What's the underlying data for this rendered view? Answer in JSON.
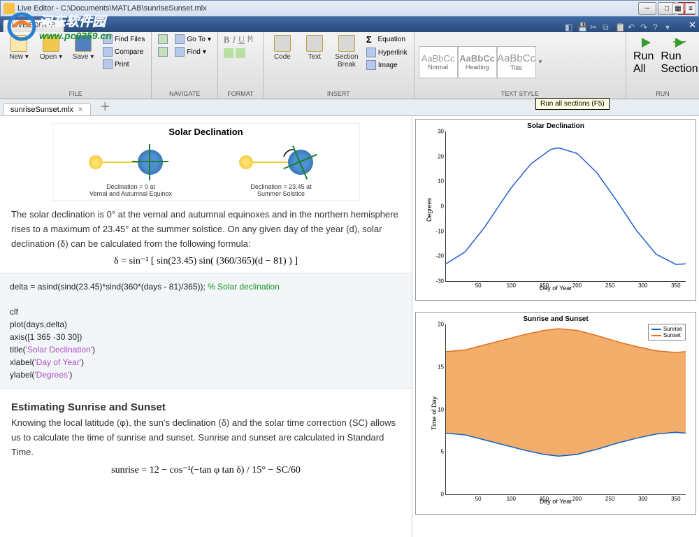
{
  "window": {
    "title": "Live Editor - C:\\Documents\\MATLAB\\sunriseSunset.mlx"
  },
  "watermark": {
    "line1": "河东软件园",
    "line2": "www.pc0359.cn"
  },
  "ribbon_tab": "LIVE EDITOR",
  "tooltip": "Run all sections (F5)",
  "groups": {
    "file": {
      "label": "FILE",
      "new": "New",
      "open": "Open",
      "save": "Save",
      "find_files": "Find Files",
      "compare": "Compare",
      "print": "Print"
    },
    "navigate": {
      "label": "NAVIGATE",
      "goto": "Go To",
      "find": "Find"
    },
    "format": {
      "label": "FORMAT"
    },
    "insert": {
      "label": "INSERT",
      "code": "Code",
      "text": "Text",
      "section": "Section\nBreak",
      "equation": "Equation",
      "hyperlink": "Hyperlink",
      "image": "Image"
    },
    "textstyle": {
      "label": "TEXT STYLE",
      "normal": "Normal",
      "heading": "Heading",
      "title": "Title",
      "sample": "AaBbCc"
    },
    "run": {
      "label": "RUN",
      "runall": "Run All",
      "runsection": "Run\nSection"
    }
  },
  "doc_tab": "sunriseSunset.mlx",
  "doc": {
    "sec1_title": "Solar Declination",
    "diag_left": "Declination = 0 at\nVernal and Autumnal Equinox",
    "diag_right": "Declination = 23.45 at\nSummer Solstice",
    "para1": "The solar declination is 0° at the vernal and autumnal equinoxes and in the northern hemisphere rises to a maximum of 23.45° at the summer solstice. On any given day of the year (d), solar declination (δ) can be calculated from the following formula:",
    "formula1": "δ = sin⁻¹ [ sin(23.45) sin( (360/365)(d − 81) ) ]",
    "code1_l1a": "delta = asind(sind(23.45)*sind(360*(days - 81)/365));    ",
    "code1_l1b": "% Solar declination",
    "code1_l2": "clf",
    "code1_l3": "plot(days,delta)",
    "code1_l4": "axis([1 365 -30 30])",
    "code1_l5a": "title(",
    "code1_l5b": "'Solar Declination'",
    "code1_l5c": ")",
    "code1_l6a": "xlabel(",
    "code1_l6b": "'Day of Year'",
    "code1_l6c": ")",
    "code1_l7a": "ylabel(",
    "code1_l7b": "'Degrees'",
    "code1_l7c": ")",
    "sec2_title": "Estimating Sunrise and Sunset",
    "para2": "Knowing the local latitude (φ), the sun's declination (δ) and the solar time correction (SC) allows us to calculate the time of sunrise and sunset. Sunrise and sunset are calculated in Standard Time.",
    "formula2": "sunrise = 12 − cos⁻¹(−tan φ tan δ) / 15° − SC/60"
  },
  "chart_data": [
    {
      "type": "line",
      "title": "Solar Declination",
      "xlabel": "Day of Year",
      "ylabel": "Degrees",
      "xlim": [
        1,
        365
      ],
      "ylim": [
        -30,
        30
      ],
      "xticks": [
        50,
        100,
        150,
        200,
        250,
        300,
        350
      ],
      "yticks": [
        -30,
        -20,
        -10,
        0,
        10,
        20,
        30
      ],
      "series": [
        {
          "name": "delta",
          "color": "#2060c8",
          "x": [
            1,
            30,
            60,
            81,
            100,
            130,
            160,
            172,
            200,
            230,
            260,
            290,
            320,
            350,
            365
          ],
          "y": [
            -23.1,
            -18.3,
            -8.3,
            0,
            7.4,
            17.0,
            22.8,
            23.45,
            21.2,
            13.5,
            2.3,
            -9.6,
            -19.2,
            -23.3,
            -23.1
          ]
        }
      ]
    },
    {
      "type": "area",
      "title": "Sunrise and Sunset",
      "xlabel": "Day of Year",
      "ylabel": "Time of Day",
      "xlim": [
        1,
        365
      ],
      "ylim": [
        0,
        20
      ],
      "xticks": [
        50,
        100,
        150,
        200,
        250,
        300,
        350
      ],
      "yticks": [
        0,
        5,
        10,
        15,
        20
      ],
      "series": [
        {
          "name": "Sunrise",
          "color": "#1060c8",
          "x": [
            1,
            30,
            60,
            90,
            120,
            150,
            172,
            200,
            230,
            260,
            290,
            320,
            350,
            365
          ],
          "y": [
            7.2,
            7.0,
            6.4,
            5.8,
            5.2,
            4.7,
            4.5,
            4.7,
            5.3,
            6.0,
            6.6,
            7.1,
            7.3,
            7.2
          ]
        },
        {
          "name": "Sunset",
          "color": "#e07020",
          "x": [
            1,
            30,
            60,
            90,
            120,
            150,
            172,
            200,
            230,
            260,
            290,
            320,
            350,
            365
          ],
          "y": [
            16.8,
            17.0,
            17.6,
            18.2,
            18.8,
            19.3,
            19.5,
            19.3,
            18.7,
            18.0,
            17.4,
            16.9,
            16.7,
            16.8
          ]
        }
      ]
    }
  ]
}
